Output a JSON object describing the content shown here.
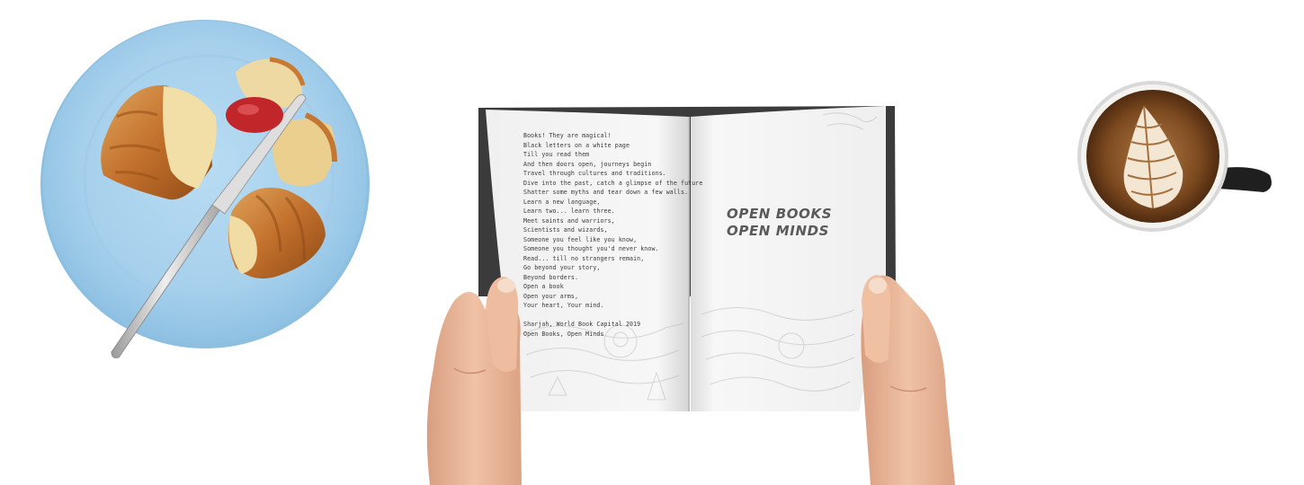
{
  "poem": {
    "lines": [
      "Books! They are magical!",
      "Black letters on a white page",
      "Till you read them",
      "And then doors open, journeys begin",
      "Travel through cultures and traditions.",
      "Dive into the past, catch a glimpse of the future",
      "Shatter some myths and tear down a few walls.",
      "Learn a new language,",
      "Learn two... learn three.",
      "Meet saints and warriors,",
      "Scientists and wizards,",
      "Someone you feel like you know,",
      "Someone you thought you'd never know.",
      "Read... till no strangers remain,",
      "Go beyond your story,",
      "Beyond borders.",
      "Open a book",
      "Open your arms,",
      "Your heart, Your mind."
    ],
    "signature_lines": [
      "Sharjah, World Book Capital 2019",
      "Open Books, Open Minds"
    ]
  },
  "headline": {
    "line1": "OPEN BOOKS",
    "line2": "OPEN MINDS"
  },
  "colors": {
    "background": "#ffffff",
    "plate": "#a9d3ee",
    "croissant": "#c9772f",
    "jam": "#c0262a",
    "coffee": "#7a4a22",
    "book_cover": "#3b3b3b",
    "page": "#f4f4f4",
    "skin": "#e9b79a"
  }
}
